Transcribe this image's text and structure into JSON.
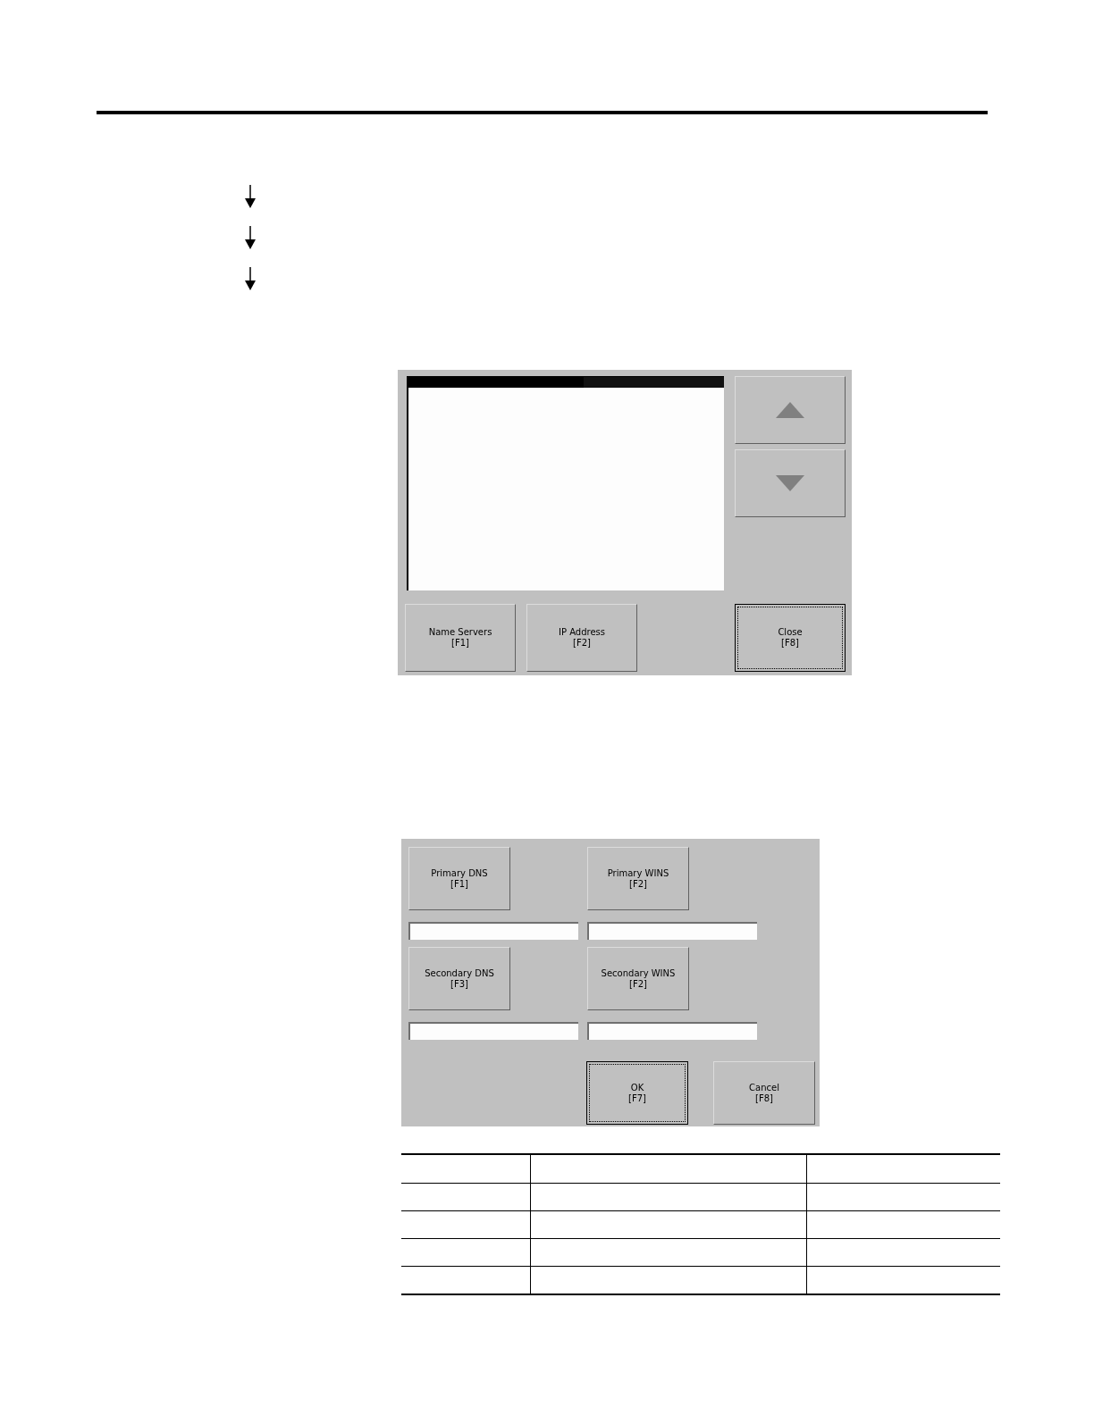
{
  "flow_arrows": [
    {
      "kind": "down"
    },
    {
      "kind": "down"
    },
    {
      "kind": "down"
    }
  ],
  "network_screen": {
    "list_header": {
      "selected": true
    },
    "scroll_buttons": [
      {
        "kind": "up"
      },
      {
        "kind": "down"
      }
    ],
    "buttons": [
      {
        "label": "Name Servers",
        "key": "[F1]",
        "focused": false
      },
      {
        "label": "IP Address",
        "key": "[F2]",
        "focused": false
      },
      {
        "label": "Close",
        "key": "[F8]",
        "focused": true
      }
    ]
  },
  "name_servers_screen": {
    "entries": [
      {
        "label": "Primary DNS",
        "key": "[F1]"
      },
      {
        "label": "Primary WINS",
        "key": "[F2]"
      },
      {
        "label": "Secondary DNS",
        "key": "[F3]"
      },
      {
        "label": "Secondary WINS",
        "key": "[F2]"
      }
    ],
    "buttons": [
      {
        "label": "OK",
        "key": "[F7]",
        "focused": true
      },
      {
        "label": "Cancel",
        "key": "[F8]",
        "focused": false
      }
    ]
  }
}
